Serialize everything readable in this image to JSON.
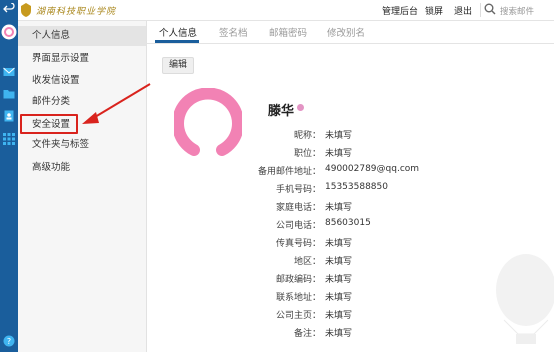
{
  "header": {
    "logo_text": "湖南科技职业学院",
    "nav": [
      "管理后台",
      "锁屏",
      "退出"
    ],
    "search_placeholder": "搜索邮件"
  },
  "rail": {
    "icons": [
      "back-icon",
      "avatar-icon",
      "mail-icon",
      "folder-icon",
      "contacts-icon",
      "apps-icon",
      "help-icon"
    ]
  },
  "sidebar": {
    "items": [
      "个人信息",
      "界面显示设置",
      "收发信设置",
      "邮件分类",
      "安全设置",
      "文件夹与标签",
      "高级功能"
    ],
    "active_index": 0,
    "highlighted_index": 4
  },
  "tabs": [
    "个人信息",
    "签名档",
    "邮箱密码",
    "修改别名"
  ],
  "edit_label": "编辑",
  "profile": {
    "name": "滕华",
    "fields": [
      {
        "label": "昵称：",
        "value": "未填写"
      },
      {
        "label": "职位：",
        "value": "未填写"
      },
      {
        "label": "备用邮件地址：",
        "value": "490002789@qq.com"
      },
      {
        "label": "手机号码：",
        "value": "15353588850"
      },
      {
        "label": "家庭电话：",
        "value": "未填写"
      },
      {
        "label": "公司电话：",
        "value": "85603015"
      },
      {
        "label": "传真号码：",
        "value": "未填写"
      },
      {
        "label": "地区：",
        "value": "未填写"
      },
      {
        "label": "邮政编码：",
        "value": "未填写"
      },
      {
        "label": "联系地址：",
        "value": "未填写"
      },
      {
        "label": "公司主页：",
        "value": "未填写"
      },
      {
        "label": "备注：",
        "value": "未填写"
      }
    ]
  },
  "colors": {
    "rail": "#1a5e9c",
    "highlight": "#d9231d",
    "avatar": "#f282b4"
  }
}
